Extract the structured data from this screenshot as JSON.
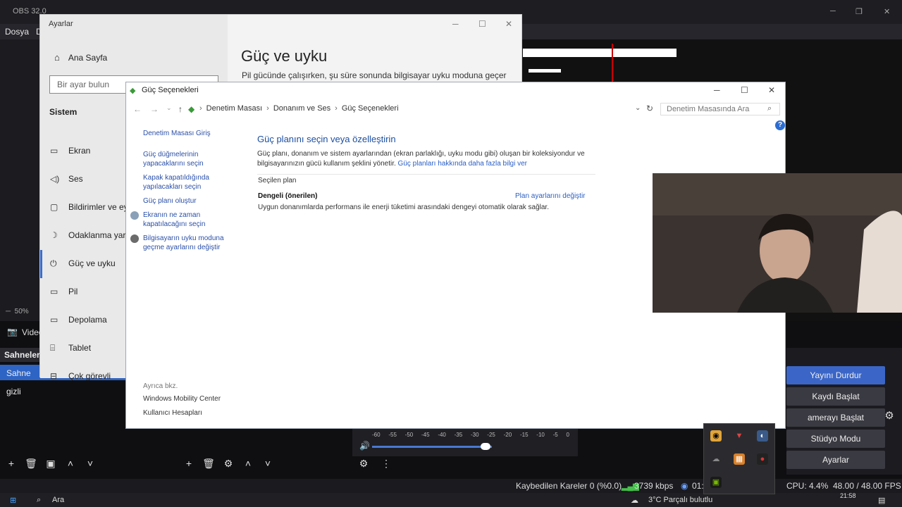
{
  "obs": {
    "title": "OBS 32.0",
    "menu": [
      "Dosya",
      "D"
    ],
    "zoom": "50%",
    "video_label": "Video",
    "scenes_header": "Sahneler",
    "scenes": [
      "Sahne",
      "gizli"
    ],
    "meter_scale": [
      "-60",
      "-55",
      "-50",
      "-45",
      "-40",
      "-35",
      "-30",
      "-25",
      "-20",
      "-15",
      "-10",
      "-5",
      "0"
    ],
    "controls": {
      "stream": "Yayını Durdur",
      "record": "Kaydı Başlat",
      "vcam": "amerayı Başlat",
      "studio": "Stüdyo Modu",
      "settings": "Ayarlar"
    },
    "status": {
      "dropped": "Kaybedilen Kareler 0 (%0.0)",
      "bitrate": "3739 kbps",
      "live_time": "01:",
      "cpu": "CPU: 4.4%",
      "fps": "48.00 / 48.00 FPS"
    }
  },
  "taskbar": {
    "search": "Ara",
    "weather": "3°C  Parçalı bulutlu",
    "time": "21:58"
  },
  "settings": {
    "title": "Ayarlar",
    "home": "Ana Sayfa",
    "search_placeholder": "Bir ayar bulun",
    "section": "Sistem",
    "nav": [
      {
        "icon": "display-icon",
        "label": "Ekran"
      },
      {
        "icon": "sound-icon",
        "label": "Ses"
      },
      {
        "icon": "notifications-icon",
        "label": "Bildirimler ve ey"
      },
      {
        "icon": "focus-icon",
        "label": "Odaklanma yard"
      },
      {
        "icon": "power-icon",
        "label": "Güç ve uyku"
      },
      {
        "icon": "battery-icon",
        "label": "Pil"
      },
      {
        "icon": "storage-icon",
        "label": "Depolama"
      },
      {
        "icon": "tablet-icon",
        "label": "Tablet"
      },
      {
        "icon": "multitask-icon",
        "label": "Çok görevli"
      }
    ],
    "heading": "Güç ve uyku",
    "subtext": "Pil gücünde çalışırken, şu süre sonunda bilgisayar uyku moduna geçer"
  },
  "power": {
    "title": "Güç Seçenekleri",
    "breadcrumbs": [
      "Denetim Masası",
      "Donanım ve Ses",
      "Güç Seçenekleri"
    ],
    "search_placeholder": "Denetim Masasında Ara",
    "help": "?",
    "left_links": [
      "Denetim Masası Giriş",
      "Güç düğmelerinin yapacaklarını seçin",
      "Kapak kapatıldığında yapılacakları seçin",
      "Güç planı oluştur",
      "Ekranın ne zaman kapatılacağını seçin",
      "Bilgisayarın uyku moduna geçme ayarlarını değiştir"
    ],
    "see_also": "Ayrıca bkz.",
    "see_also_links": [
      "Windows Mobility Center",
      "Kullanıcı Hesapları"
    ],
    "main_heading": "Güç planını seçin veya özelleştirin",
    "main_desc": "Güç planı, donanım ve sistem ayarlarından (ekran parlaklığı, uyku modu gibi) oluşan bir koleksiyondur ve bilgisayarınızın gücü kullanım şeklini yönetir.",
    "main_link": "Güç planları hakkında daha fazla bilgi ver",
    "plan_section": "Seçilen plan",
    "plan_name": "Dengeli (önerilen)",
    "plan_change": "Plan ayarlarını değiştir",
    "plan_desc": "Uygun donanımlarda performans ile enerji tüketimi arasındaki dengeyi otomatik olarak sağlar."
  },
  "colors": {
    "accent": "#3b66c8",
    "link": "#2b50a8",
    "obs_bg": "#1d1d22"
  }
}
